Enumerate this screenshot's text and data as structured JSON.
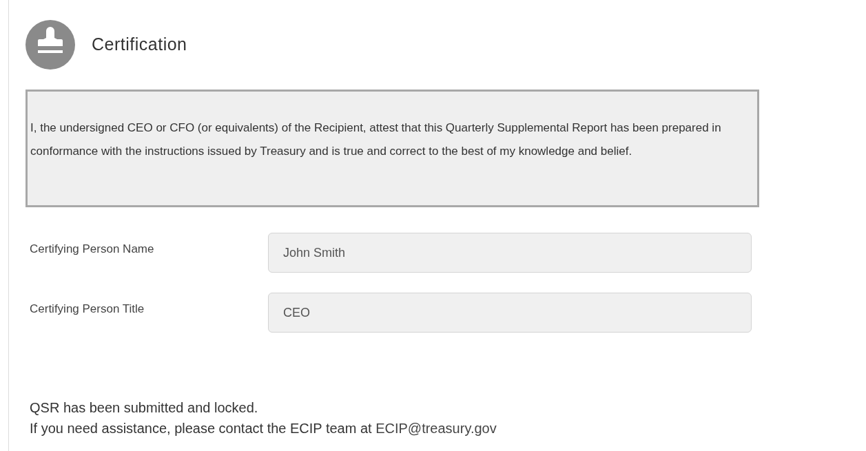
{
  "section": {
    "title": "Certification"
  },
  "attestation": "I, the undersigned CEO or CFO (or equivalents) of the Recipient, attest that this Quarterly Supplemental Report has been prepared in conformance with the instructions issued by Treasury and is true and correct to the best of my knowledge and belief.",
  "fields": [
    {
      "label": "Certifying Person Name",
      "value": "John Smith",
      "disabled": true
    },
    {
      "label": "Certifying Person Title",
      "value": "CEO",
      "disabled": true
    }
  ],
  "status_message": "QSR has been submitted and locked.",
  "contact": {
    "text": "If you need assistance, please contact the ECIP team at",
    "email": "ECIP@treasury.gov"
  }
}
